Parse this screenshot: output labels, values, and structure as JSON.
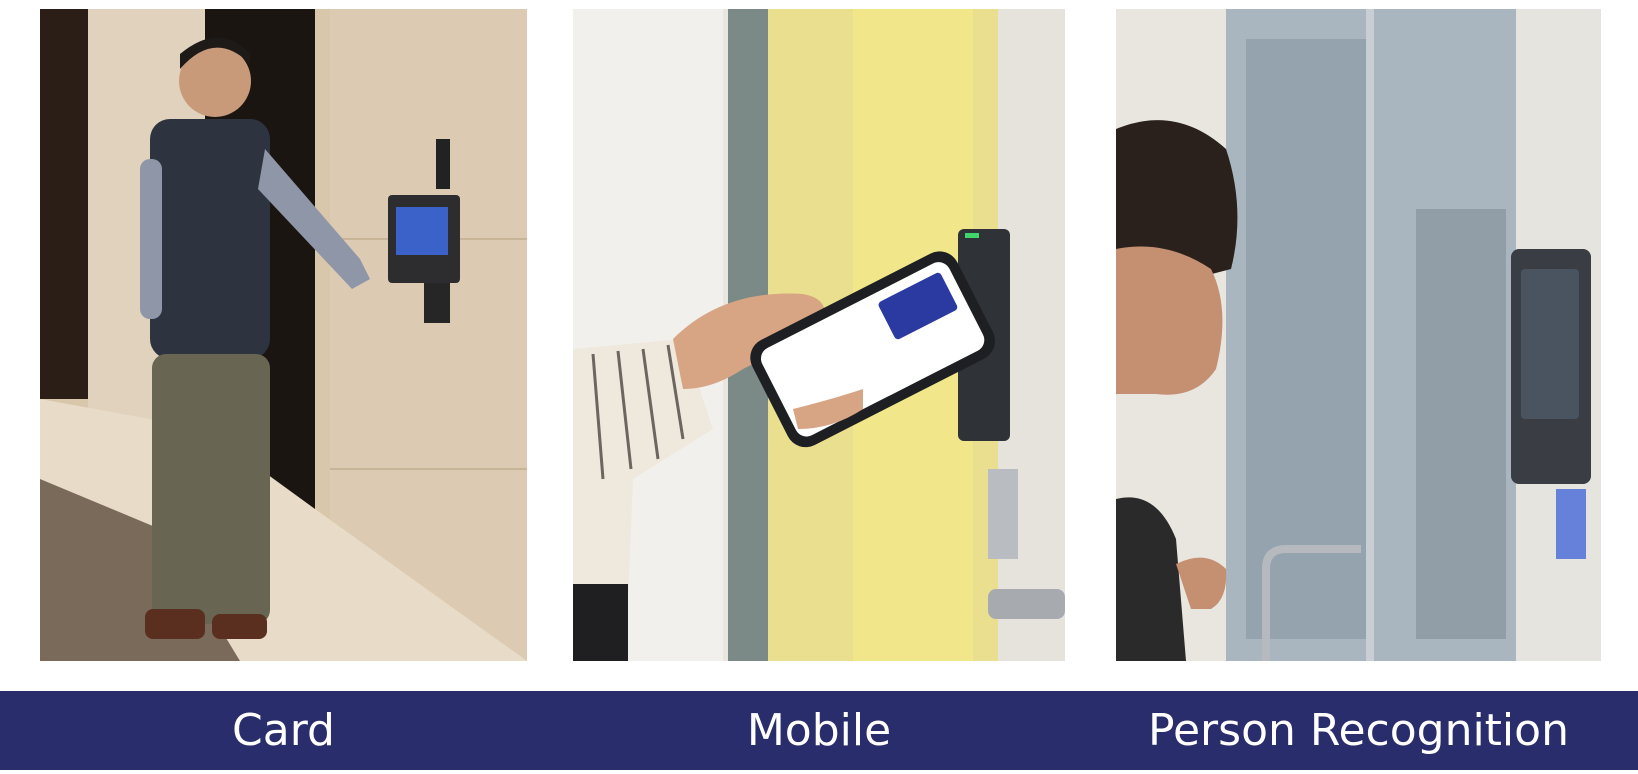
{
  "panels": [
    {
      "caption": "Card",
      "photo": "man-badging-card-at-elevator-reader"
    },
    {
      "caption": "Mobile",
      "photo": "hand-holding-phone-at-door-reader"
    },
    {
      "caption": "Person Recognition",
      "photo": "woman-at-face-recognition-reader"
    }
  ],
  "colors": {
    "caption_bar": "#2a2d6b",
    "caption_text": "#ffffff"
  }
}
